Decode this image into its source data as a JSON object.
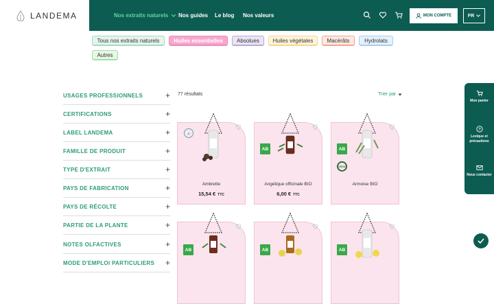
{
  "header": {
    "brand": "LANDEMA",
    "nav": [
      "Nos extraits naturels",
      "Nos guides",
      "Le blog",
      "Nos valeurs"
    ],
    "account_label": "MON COMPTE",
    "lang_label": "FR",
    "icons": [
      "search-icon",
      "heart-icon",
      "cart-icon",
      "user-icon",
      "chevron-down-icon"
    ],
    "accent_color": "#0d5c52",
    "nav_active_color": "#5ed6a0"
  },
  "categories": [
    {
      "label": "Tous nos extraits naturels",
      "color": "#a7d9c2"
    },
    {
      "label": "Huiles essentielles",
      "color": "#f7a8cc",
      "active": true
    },
    {
      "label": "Absolues",
      "color": "#b9a7d8"
    },
    {
      "label": "Huiles végétales",
      "color": "#f5d78a"
    },
    {
      "label": "Macérâts",
      "color": "#f3a58f"
    },
    {
      "label": "Hydrolats",
      "color": "#a8cdee"
    },
    {
      "label": "Autres",
      "color": "#a5dfa7"
    }
  ],
  "filters": [
    "USAGES PROFESSIONNELS",
    "CERTIFICATIONS",
    "LABEL LANDEMA",
    "FAMILLE DE PRODUIT",
    "TYPE D'EXTRAIT",
    "PAYS DE FABRICATION",
    "PAYS DE RÉCOLTE",
    "PARTIE DE LA PLANTE",
    "NOTES OLFACTIVES",
    "MODE D'EMPLOI PARTICULIERS"
  ],
  "results": {
    "count": "77 résultats",
    "sort_label": "Trier par"
  },
  "products": [
    {
      "name": "Ambrette",
      "price": "15,54 €",
      "tax": "TTC",
      "organic": false
    },
    {
      "name": "Angélique officinale BIO",
      "price": "6,00 €",
      "tax": "TTC",
      "organic": true
    },
    {
      "name": "Armoise BIO",
      "price": "",
      "tax": "",
      "organic": true,
      "usda": true
    },
    {
      "name": "",
      "price": "",
      "tax": "",
      "organic": true
    },
    {
      "name": "",
      "price": "",
      "tax": "",
      "organic": true
    },
    {
      "name": "",
      "price": "",
      "tax": "",
      "organic": true
    }
  ],
  "badges": {
    "ab": "AB",
    "usda": "USDA"
  },
  "side_panel": {
    "cart": "Mon panier",
    "lexicon": "Lexique et précautions",
    "contact": "Nous contacter"
  }
}
